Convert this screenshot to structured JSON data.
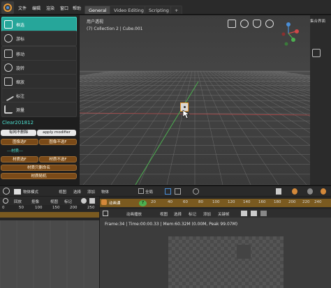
{
  "topbar": {
    "menus": [
      "文件",
      "编辑",
      "渲染",
      "窗口",
      "帮助"
    ],
    "tabs": [
      "General",
      "Video Editing",
      "Scripting"
    ],
    "add_tab": "+"
  },
  "tools": [
    {
      "label": "框选",
      "icon": "select-box-icon",
      "active": true
    },
    {
      "label": "游标",
      "icon": "cursor-icon",
      "active": false
    },
    {
      "label": "移动",
      "icon": "move-icon",
      "active": false
    },
    {
      "label": "旋转",
      "icon": "rotate-icon",
      "active": false
    },
    {
      "label": "缩放",
      "icon": "scale-icon",
      "active": false
    },
    {
      "label": "标注",
      "icon": "annotate-icon",
      "active": false
    },
    {
      "label": "测量",
      "icon": "measure-icon",
      "active": false
    }
  ],
  "addon": {
    "title": "Clear201812",
    "row1": [
      "有网不删除",
      "apply modifier"
    ],
    "row2": [
      "图像选F",
      "图像不选F"
    ],
    "section": "---材质---",
    "row3": [
      "材质选F",
      "材质不选F"
    ],
    "btn_material_name": "材质只删命名",
    "btn_material_random": "材质随机"
  },
  "viewport": {
    "title": "用户透视",
    "subtitle": "(7) Collection 2 | Cube.001",
    "side_label": "集合界面"
  },
  "bottom": {
    "mode": "物体模式",
    "view": "视图",
    "select": "选择",
    "add": "添加",
    "object": "物体",
    "global": "全局",
    "playback": "回放",
    "keying": "抠像",
    "view2": "视图",
    "marker": "标记",
    "current_frame": "7",
    "ruler_left": [
      "0",
      "50",
      "100",
      "150",
      "200",
      "250"
    ],
    "ruler_right": [
      "20",
      "40",
      "60",
      "80",
      "100",
      "120",
      "140",
      "160",
      "180",
      "200",
      "220",
      "240",
      "260"
    ],
    "seq_label": "动画课",
    "seq_mode": "动画播放",
    "seq_menus": [
      "视图",
      "选择",
      "标记",
      "添加",
      "关键帧"
    ],
    "status": "Frame:34 | Time:00:00.33 | Mem:60.32M (0.00M, Peak 99.07M)"
  },
  "colors": {
    "accent": "#26a69a",
    "brown": "#7a4a18",
    "orange": "#d4893a"
  }
}
